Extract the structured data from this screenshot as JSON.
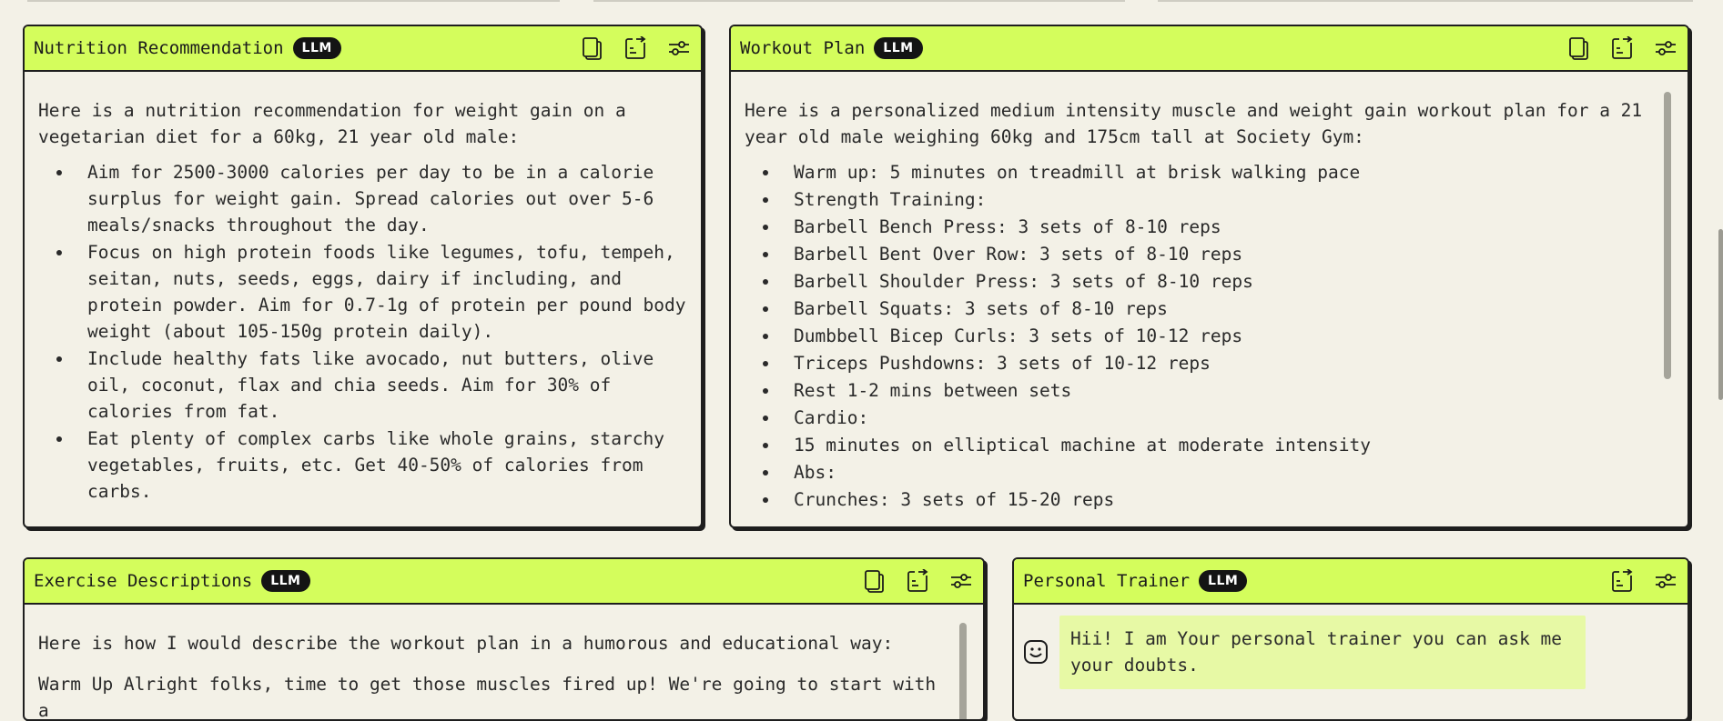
{
  "badge_label": "LLM",
  "nutrition": {
    "title": "Nutrition Recommendation",
    "intro": "Here is a nutrition recommendation for weight gain on a vegetarian diet for a 60kg, 21 year old male:",
    "items": [
      "Aim for 2500-3000 calories per day to be in a calorie surplus for weight gain. Spread calories out over 5-6 meals/snacks throughout the day.",
      "Focus on high protein foods like legumes, tofu, tempeh, seitan, nuts, seeds, eggs, dairy if including, and protein powder. Aim for 0.7-1g of protein per pound body weight (about 105-150g protein daily).",
      "Include healthy fats like avocado, nut butters, olive oil, coconut, flax and chia seeds. Aim for 30% of calories from fat.",
      "Eat plenty of complex carbs like whole grains, starchy vegetables, fruits, etc. Get 40-50% of calories from carbs."
    ]
  },
  "workout": {
    "title": "Workout Plan",
    "intro": "Here is a personalized medium intensity muscle and weight gain workout plan for a 21 year old male weighing 60kg and 175cm tall at Society Gym:",
    "items": [
      "Warm up: 5 minutes on treadmill at brisk walking pace",
      "Strength Training:",
      "Barbell Bench Press: 3 sets of 8-10 reps",
      "Barbell Bent Over Row: 3 sets of 8-10 reps",
      "Barbell Shoulder Press: 3 sets of 8-10 reps",
      "Barbell Squats: 3 sets of 8-10 reps",
      "Dumbbell Bicep Curls: 3 sets of 10-12 reps",
      "Triceps Pushdowns: 3 sets of 10-12 reps",
      "Rest 1-2 mins between sets",
      "Cardio:",
      "15 minutes on elliptical machine at moderate intensity",
      "Abs:",
      "Crunches: 3 sets of 15-20 reps"
    ]
  },
  "exercise": {
    "title": "Exercise Descriptions",
    "intro": "Here is how I would describe the workout plan in a humorous and educational way:",
    "para": "Warm Up Alright folks, time to get those muscles fired up! We're going to start with a"
  },
  "trainer": {
    "title": "Personal Trainer",
    "message": "Hii! I am Your personal trainer you can ask me your doubts."
  },
  "icons": {
    "copy": "copy-icon",
    "export": "export-icon",
    "settings": "sliders-icon",
    "avatar": "smiley-icon"
  },
  "colors": {
    "header": "#d4fd5c",
    "background": "#f3f1e7",
    "badge": "#141414",
    "chat_bubble": "#e7f9a5"
  }
}
